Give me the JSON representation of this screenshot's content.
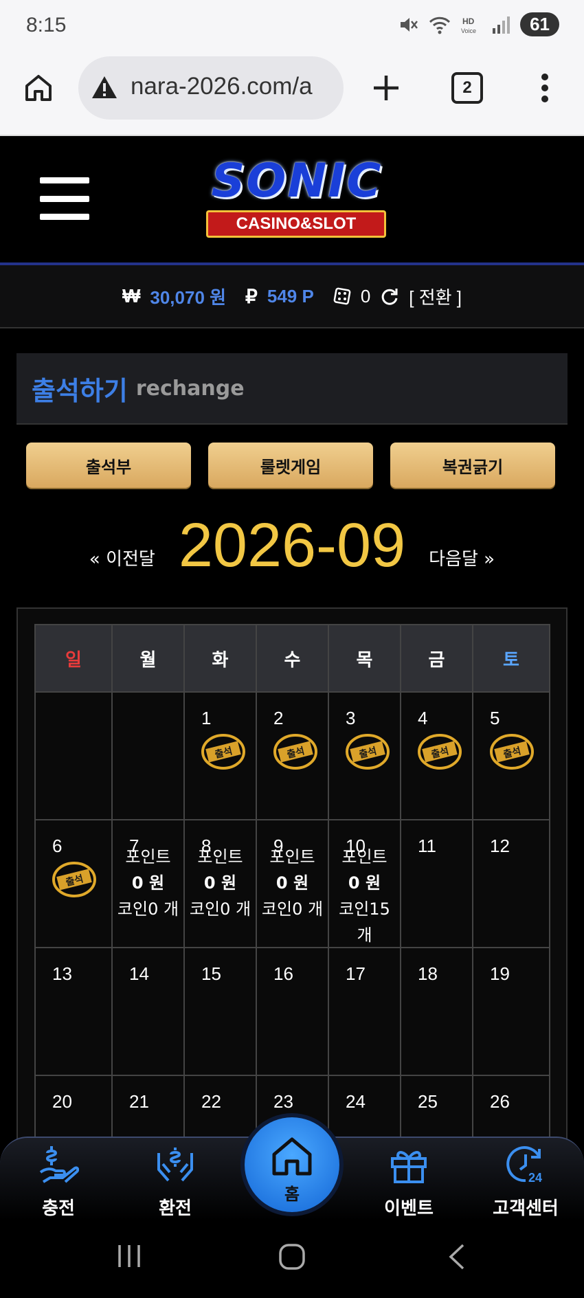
{
  "status": {
    "time": "8:15",
    "battery": "61"
  },
  "browser": {
    "url": "nara-2026.com/a",
    "tab_count": "2"
  },
  "balance": {
    "won_symbol": "₩",
    "won_value": "30,070 원",
    "point_symbol": "₽",
    "point_value": "549 P",
    "coin_value": "0",
    "convert_label": "[ 전환 ]"
  },
  "section": {
    "title_ko": "출석하기",
    "title_en": "rechange"
  },
  "buttons": [
    "출석부",
    "룰렛게임",
    "복권긁기"
  ],
  "calendar": {
    "prev": "« 이전달",
    "month": "2026-09",
    "next": "다음달 »",
    "weekdays": [
      "일",
      "월",
      "화",
      "수",
      "목",
      "금",
      "토"
    ],
    "weekday_colors": [
      "#e83b3b",
      "#ffffff",
      "#ffffff",
      "#ffffff",
      "#ffffff",
      "#ffffff",
      "#5aa6ff"
    ],
    "stamp_text": "출석",
    "weeks": [
      [
        {
          "d": ""
        },
        {
          "d": ""
        },
        {
          "d": "1",
          "stamp": true
        },
        {
          "d": "2",
          "stamp": true
        },
        {
          "d": "3",
          "stamp": true
        },
        {
          "d": "4",
          "stamp": true
        },
        {
          "d": "5",
          "stamp": true
        }
      ],
      [
        {
          "d": "6",
          "stamp": true
        },
        {
          "d": "7",
          "pts": [
            "포인트",
            "0 원",
            "코인0 개"
          ]
        },
        {
          "d": "8",
          "pts": [
            "포인트",
            "0 원",
            "코인0 개"
          ]
        },
        {
          "d": "9",
          "pts": [
            "포인트",
            "0 원",
            "코인0 개"
          ]
        },
        {
          "d": "10",
          "pts": [
            "포인트",
            "0 원",
            "코인15",
            "개"
          ]
        },
        {
          "d": "11"
        },
        {
          "d": "12"
        }
      ],
      [
        {
          "d": "13"
        },
        {
          "d": "14"
        },
        {
          "d": "15"
        },
        {
          "d": "16"
        },
        {
          "d": "17"
        },
        {
          "d": "18"
        },
        {
          "d": "19"
        }
      ],
      [
        {
          "d": "20"
        },
        {
          "d": "21"
        },
        {
          "d": "22"
        },
        {
          "d": "23"
        },
        {
          "d": "24"
        },
        {
          "d": "25"
        },
        {
          "d": "26"
        }
      ]
    ]
  },
  "bottom_nav": {
    "charge": "충전",
    "exchange": "환전",
    "home": "홈",
    "event": "이벤트",
    "support": "고객센터"
  },
  "colors": {
    "accent_blue": "#3d7fe6",
    "gold": "#f2c744",
    "button_gold": "#e6be79"
  }
}
